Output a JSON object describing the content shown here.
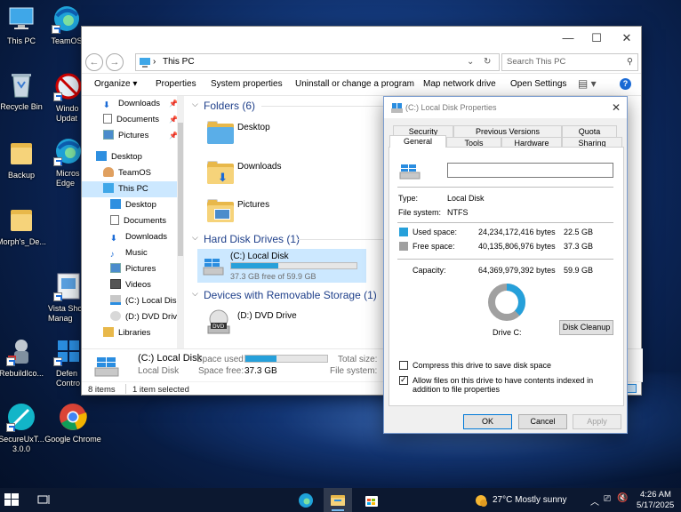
{
  "desktop": {
    "icons": [
      {
        "label": "This PC"
      },
      {
        "label": "TeamOS"
      },
      {
        "label": "Recycle Bin"
      },
      {
        "label": "Windo Updat"
      },
      {
        "label": "Backup"
      },
      {
        "label": "Micros Edge"
      },
      {
        "label": "Morph's_De..."
      },
      {
        "label": "Vista Sho Manag"
      },
      {
        "label": "RebuildIco..."
      },
      {
        "label": "Defen Contro"
      },
      {
        "label": "SecureUxT... 3.0.0"
      },
      {
        "label": "Google Chrome"
      }
    ]
  },
  "explorer": {
    "address": "This PC",
    "search_placeholder": "Search This PC",
    "toolbar": [
      "Organize ▾",
      "Properties",
      "System properties",
      "Uninstall or change a program",
      "Map network drive",
      "Open Settings"
    ],
    "nav": {
      "quick": [
        {
          "label": "Downloads"
        },
        {
          "label": "Documents"
        },
        {
          "label": "Pictures"
        }
      ],
      "tree": [
        {
          "label": "Desktop"
        },
        {
          "label": "TeamOS"
        },
        {
          "label": "This PC"
        },
        {
          "label": "Desktop"
        },
        {
          "label": "Documents"
        },
        {
          "label": "Downloads"
        },
        {
          "label": "Music"
        },
        {
          "label": "Pictures"
        },
        {
          "label": "Videos"
        },
        {
          "label": "(C:) Local Disk"
        },
        {
          "label": "(D:) DVD Drive"
        },
        {
          "label": "Libraries"
        }
      ]
    },
    "groups": {
      "folders": "Folders (6)",
      "drives": "Hard Disk Drives (1)",
      "removable": "Devices with Removable Storage (1)"
    },
    "folders": [
      {
        "label": "Desktop"
      },
      {
        "label": "Downloads"
      },
      {
        "label": "Pictures"
      }
    ],
    "drive_c": {
      "label": "(C:) Local Disk",
      "free_text": "37.3 GB free of 59.9 GB",
      "used_fraction": 0.377
    },
    "drive_d": {
      "label": "(D:) DVD Drive"
    },
    "details": {
      "name": "(C:) Local Disk",
      "type": "Local Disk",
      "space_used_label": "Space used:",
      "space_free_label": "Space free:",
      "space_free_value": "37.3 GB",
      "total_size_label": "Total size:",
      "file_system_label": "File system:"
    },
    "status": {
      "items": "8 items",
      "selected": "1 item selected"
    }
  },
  "properties": {
    "title": "(C:) Local Disk Properties",
    "tabs_top": [
      "Security",
      "Previous Versions",
      "Quota"
    ],
    "tabs_bottom": [
      "General",
      "Tools",
      "Hardware",
      "Sharing"
    ],
    "type_label": "Type:",
    "type_value": "Local Disk",
    "fs_label": "File system:",
    "fs_value": "NTFS",
    "used_label": "Used space:",
    "used_bytes": "24,234,172,416 bytes",
    "used_gb": "22.5 GB",
    "free_label": "Free space:",
    "free_bytes": "40,135,806,976 bytes",
    "free_gb": "37.3 GB",
    "capacity_label": "Capacity:",
    "capacity_bytes": "64,369,979,392 bytes",
    "capacity_gb": "59.9 GB",
    "drive_label": "Drive C:",
    "disk_cleanup": "Disk Cleanup",
    "compress_label": "Compress this drive to save disk space",
    "index_label": "Allow files on this drive to have contents indexed in addition to file properties",
    "ok": "OK",
    "cancel": "Cancel",
    "apply": "Apply",
    "used_color": "#26a0da",
    "free_color": "#a0a0a0",
    "used_fraction": 0.377
  },
  "taskbar": {
    "weather": "27°C  Mostly sunny",
    "time": "4:26 AM",
    "date": "5/17/2025"
  }
}
